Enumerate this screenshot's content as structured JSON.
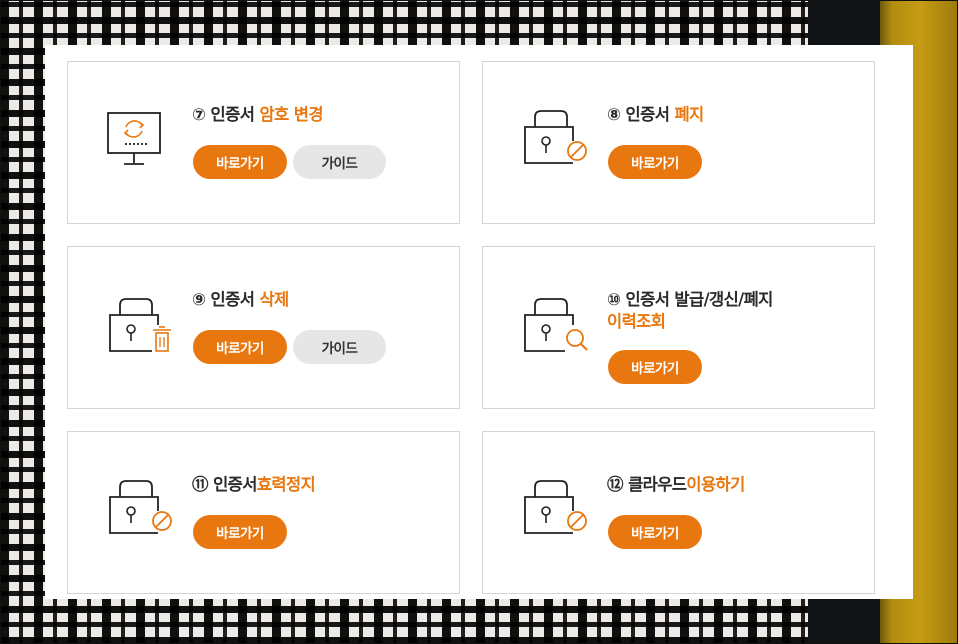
{
  "colors": {
    "accent": "#e8770f",
    "guide_bg": "#e6e6e6",
    "border": "#d4d4d4"
  },
  "cards": [
    {
      "number": "⑦",
      "title_plain": "인증서",
      "title_accent": "암호 변경",
      "go_label": "바로가기",
      "guide_label": "가이드",
      "icon": "monitor-refresh-icon"
    },
    {
      "number": "⑧",
      "title_plain": "인증서",
      "title_accent": "폐지",
      "go_label": "바로가기",
      "icon": "lock-prohibit-icon"
    },
    {
      "number": "⑨",
      "title_plain": "인증서",
      "title_accent": "삭제",
      "go_label": "바로가기",
      "guide_label": "가이드",
      "icon": "lock-trash-icon"
    },
    {
      "number": "⑩",
      "title_plain": "인증서 발급/갱신/폐지",
      "title_accent": "이력조회",
      "go_label": "바로가기",
      "icon": "lock-search-icon"
    },
    {
      "number": "⑪",
      "title_plain": "인증서",
      "title_accent": "효력정지",
      "go_label": "바로가기",
      "icon": "lock-prohibit-icon"
    },
    {
      "number": "⑫",
      "title_plain": "클라우드",
      "title_accent": "이용하기",
      "go_label": "바로가기",
      "icon": "lock-prohibit-icon"
    }
  ]
}
